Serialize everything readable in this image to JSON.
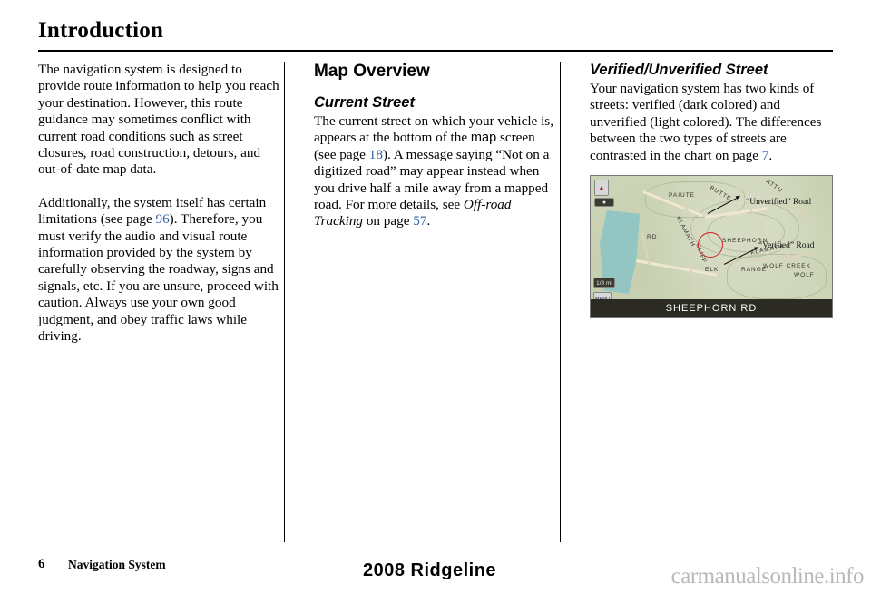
{
  "page": {
    "title": "Introduction",
    "footer_page_number": "6",
    "footer_label": "Navigation System",
    "footer_center": "2008  Ridgeline",
    "watermark": "carmanualsonline.info"
  },
  "column_left": {
    "paragraph_1": "The navigation system is designed to provide route information to help you reach your destination. However, this route guidance may sometimes conflict with current road conditions such as street closures, road construction, detours, and out-of-date map data.",
    "paragraph_2_part1": "Additionally, the system itself has certain limitations (see page ",
    "paragraph_2_ref": "96",
    "paragraph_2_part2": "). Therefore, you must verify the audio and visual route information provided by the system by carefully observing the roadway, signs and signals, etc. If you are unsure, proceed with caution. Always use your own good judgment, and obey traffic laws while driving."
  },
  "column_middle": {
    "heading": "Map Overview",
    "subheading": "Current Street",
    "body_part1": "The current street on which your vehicle is, appears at the bottom of the ",
    "body_map_word": "map",
    "body_part2": " screen (see page ",
    "body_ref_18": "18",
    "body_part3": "). A message saying “Not on a digitized road” may appear instead when you drive half a mile away from a mapped road. For more details, see ",
    "body_italic": "Off-road Tracking",
    "body_part4": " on page ",
    "body_ref_57": "57",
    "body_part5": "."
  },
  "column_right": {
    "heading": "Verified/Unverified Street",
    "body_part1": "Your navigation system has two kinds of streets: verified (dark colored) and unverified (light colored). The differences between the two types of streets are contrasted in the chart on page ",
    "body_ref_7": "7",
    "body_part2": "."
  },
  "map_figure": {
    "bottom_bar_street": "SHEEPHORN RD",
    "scale_label": "1/8 mi",
    "icon_menu": "MENU",
    "icon_compass": "N",
    "callout_unverified": "“Unverified” Road",
    "callout_verified": "“Verified” Road",
    "street_labels": [
      "SHEEPHORN",
      "BUTTE",
      "KLAMATH",
      "KLAMATH",
      "WOLF",
      "ELK",
      "CLIFF",
      "PAIUTE",
      "ATTU",
      "WOLF CREEK",
      "RD",
      "RANGE"
    ]
  },
  "colors": {
    "page_ref": "#3060a8",
    "map_water": "#93c6c2",
    "map_land": "#cdd3bc",
    "map_bar": "#2b2b23",
    "watermark": "#b9b9b9"
  }
}
